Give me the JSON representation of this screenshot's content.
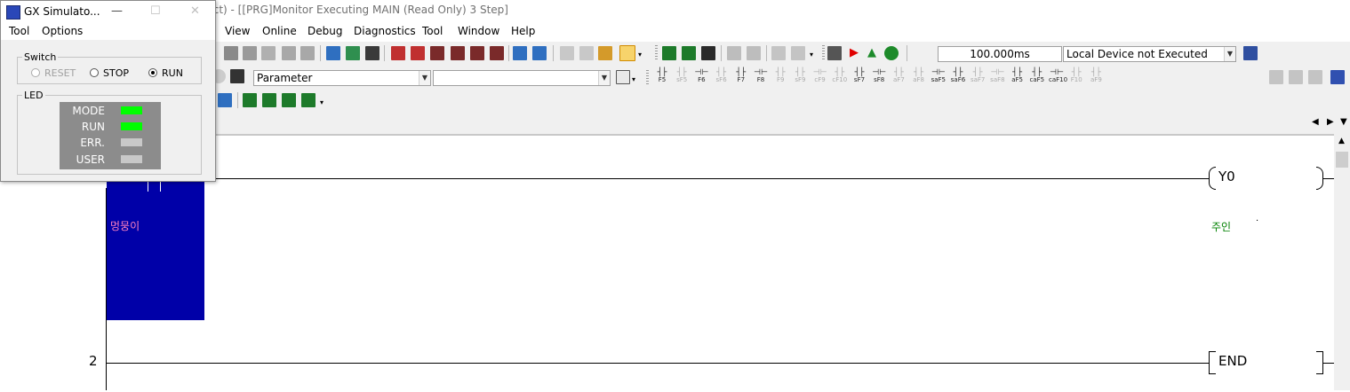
{
  "main_window": {
    "title": "ject) - [[PRG]Monitor Executing MAIN (Read Only) 3 Step]"
  },
  "menu": [
    "View",
    "Online",
    "Debug",
    "Diagnostics",
    "Tool",
    "Window",
    "Help"
  ],
  "toolbar": {
    "scan_time": "100.000ms",
    "device_status": "Local Device not Executed",
    "parameter_combo": "Parameter",
    "second_combo": ""
  },
  "function_keys": [
    {
      "label": "F5",
      "dim": false
    },
    {
      "label": "sF5",
      "dim": true
    },
    {
      "label": "F6",
      "dim": false
    },
    {
      "label": "sF6",
      "dim": true
    },
    {
      "label": "F7",
      "dim": false
    },
    {
      "label": "F8",
      "dim": false
    },
    {
      "label": "F9",
      "dim": true
    },
    {
      "label": "sF9",
      "dim": true
    },
    {
      "label": "cF9",
      "dim": true
    },
    {
      "label": "cF10",
      "dim": true
    },
    {
      "label": "sF7",
      "dim": false
    },
    {
      "label": "sF8",
      "dim": false
    },
    {
      "label": "aF7",
      "dim": true
    },
    {
      "label": "aF8",
      "dim": true
    },
    {
      "label": "saF5",
      "dim": false
    },
    {
      "label": "saF6",
      "dim": false
    },
    {
      "label": "saF7",
      "dim": true
    },
    {
      "label": "saF8",
      "dim": true
    },
    {
      "label": "aF5",
      "dim": false
    },
    {
      "label": "caF5",
      "dim": false
    },
    {
      "label": "caF10",
      "dim": false
    },
    {
      "label": "F10",
      "dim": true
    },
    {
      "label": "aF9",
      "dim": true
    }
  ],
  "ladder": {
    "rung1": {
      "coil": "Y0",
      "contact_comment": "멍뭉이",
      "coil_comment": "주인"
    },
    "rung2": {
      "step": "2",
      "instruction": "END"
    }
  },
  "simulator": {
    "title": "GX Simulato...",
    "menu": [
      "Tool",
      "Options"
    ],
    "switch_group": "Switch",
    "switch_options": [
      "RESET",
      "STOP",
      "RUN"
    ],
    "switch_selected": "RUN",
    "led_group": "LED",
    "leds": [
      {
        "name": "MODE",
        "color": "#00ff00"
      },
      {
        "name": "RUN",
        "color": "#00ff00"
      },
      {
        "name": "ERR.",
        "color": "#c8c8c8"
      },
      {
        "name": "USER",
        "color": "#c8c8c8"
      }
    ]
  },
  "colors": {
    "selection_blue": "#0000a8",
    "led_on": "#00ff00",
    "led_off": "#c8c8c8",
    "comment_green": "#008000",
    "comment_pink": "#ff80c0"
  }
}
